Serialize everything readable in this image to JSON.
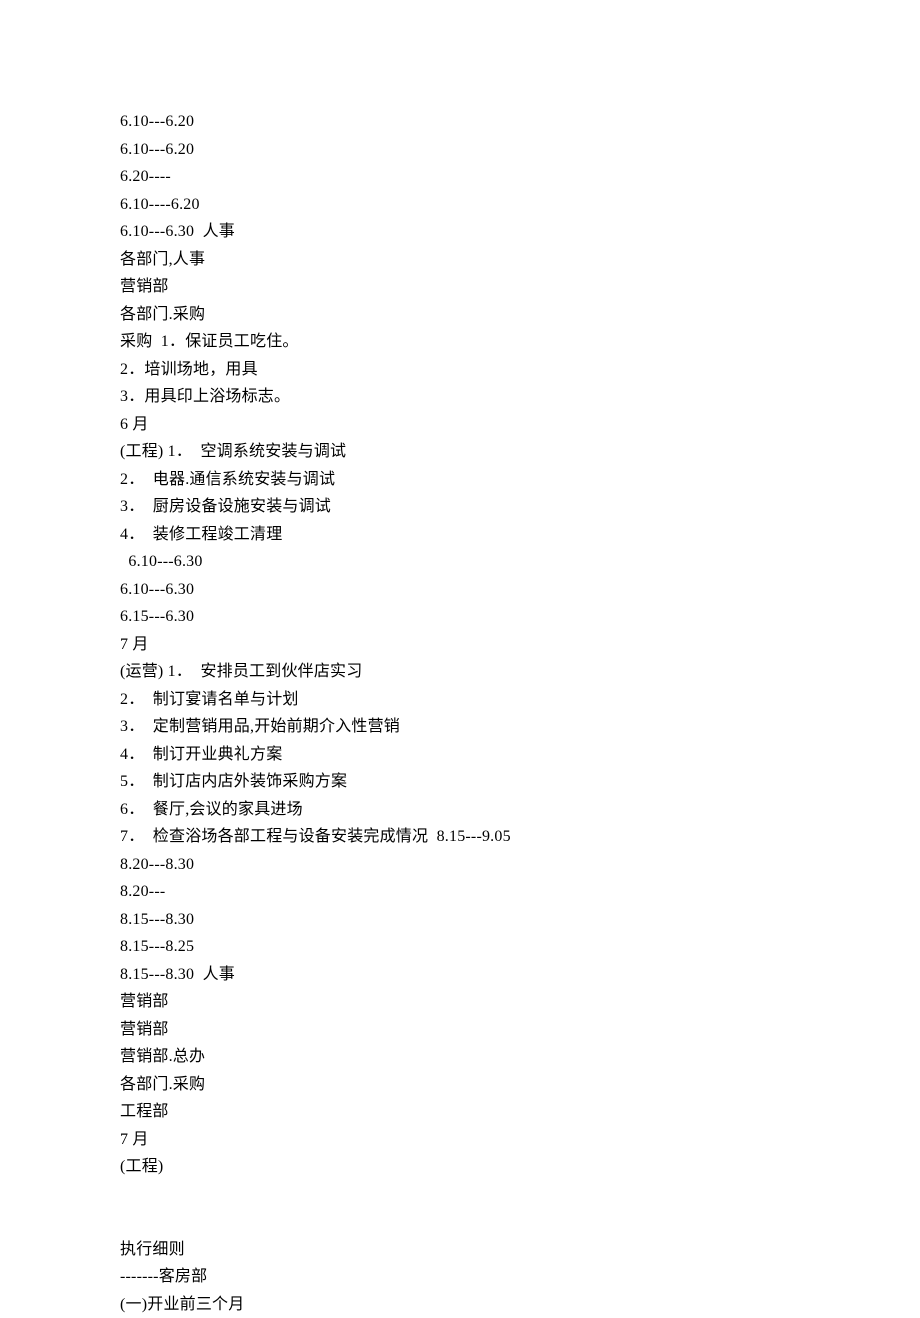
{
  "lines": [
    "6.10---6.20",
    "6.10---6.20",
    "6.20----",
    "6.10----6.20",
    "6.10---6.30  人事",
    "各部门,人事",
    "营销部",
    "各部门.采购",
    "采购  1．保证员工吃住。",
    "2．培训场地，用具",
    "3．用具印上浴场标志。",
    "6 月",
    "(工程) 1．  空调系统安装与调试",
    "2．  电器.通信系统安装与调试",
    "3．  厨房设备设施安装与调试",
    "4．  装修工程竣工清理",
    "  6.10---6.30",
    "6.10---6.30",
    "6.15---6.30",
    "7 月",
    "(运营) 1．  安排员工到伙伴店实习",
    "2．  制订宴请名单与计划",
    "3．  定制营销用品,开始前期介入性营销",
    "4．  制订开业典礼方案",
    "5．  制订店内店外装饰采购方案",
    "6．  餐厅,会议的家具进场",
    "7．  检查浴场各部工程与设备安装完成情况  8.15---9.05",
    "8.20---8.30",
    "8.20---",
    "8.15---8.30",
    "8.15---8.25",
    "8.15---8.30  人事",
    "营销部",
    "营销部",
    "营销部.总办",
    "各部门.采购",
    "工程部",
    "7 月",
    "(工程)",
    "",
    "",
    "执行细则",
    "-------客房部",
    "(一)开业前三个月"
  ]
}
